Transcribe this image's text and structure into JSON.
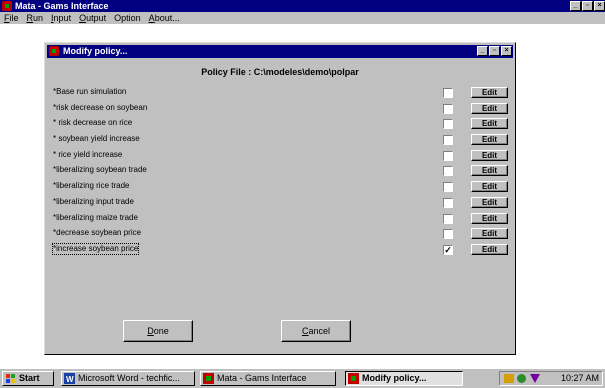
{
  "main_window": {
    "title": "Mata - Gams Interface",
    "menu": [
      {
        "first": "F",
        "rest": "ile"
      },
      {
        "first": "R",
        "rest": "un"
      },
      {
        "first": "I",
        "rest": "nput"
      },
      {
        "first": "O",
        "rest": "utput"
      },
      {
        "first": "O",
        "rest": "ption"
      },
      {
        "first": "A",
        "rest": "bout..."
      }
    ]
  },
  "dialog": {
    "title": "Modify policy...",
    "policy_file": "Policy File : C:\\modeles\\demo\\polpar",
    "edit_label": "Edit",
    "check_mark": "✓",
    "policies": [
      {
        "label": "*Base run simulation",
        "checked": false
      },
      {
        "label": "*risk decrease on soybean",
        "checked": false
      },
      {
        "label": "* risk decrease on rice",
        "checked": false
      },
      {
        "label": "* soybean yield increase",
        "checked": false
      },
      {
        "label": "* rice yield increase",
        "checked": false
      },
      {
        "label": "*liberalizing soybean trade",
        "checked": false
      },
      {
        "label": "*liberalizing rice trade",
        "checked": false
      },
      {
        "label": "*liberalizing input trade",
        "checked": false
      },
      {
        "label": "*liberalizing maize trade",
        "checked": false
      },
      {
        "label": "*decrease soybean price",
        "checked": false
      },
      {
        "label": "*increase soybean price",
        "checked": true
      }
    ],
    "done_button": {
      "first": "D",
      "rest": "one"
    },
    "cancel_button": {
      "first": "C",
      "rest": "ancel"
    }
  },
  "taskbar": {
    "start": "Start",
    "tasks": [
      "Microsoft Word - techfic...",
      "Mata - Gams Interface",
      "Modify policy..."
    ],
    "clock": "10:27 AM"
  },
  "colors": {
    "titlebar": "#000080",
    "face": "#c0c0c0"
  }
}
